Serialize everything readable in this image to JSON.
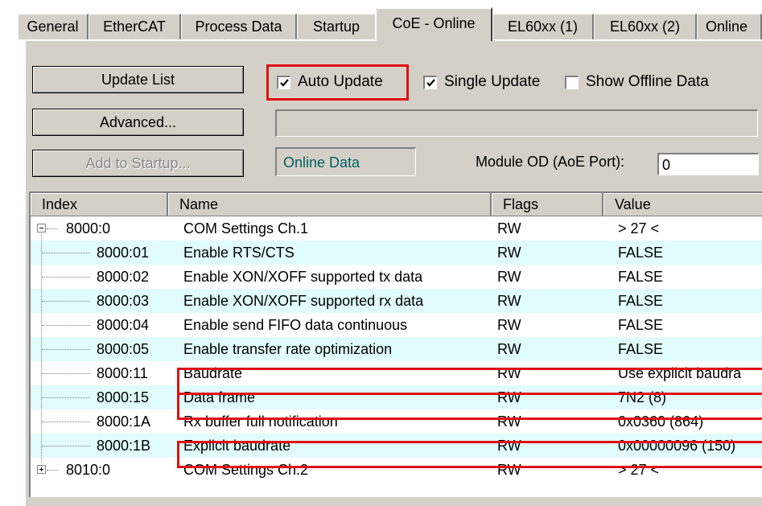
{
  "tabs": [
    {
      "label": "General",
      "active": false
    },
    {
      "label": "EtherCAT",
      "active": false
    },
    {
      "label": "Process Data",
      "active": false
    },
    {
      "label": "Startup",
      "active": false
    },
    {
      "label": "CoE - Online",
      "active": true
    },
    {
      "label": "EL60xx (1)",
      "active": false
    },
    {
      "label": "EL60xx (2)",
      "active": false
    },
    {
      "label": "Online",
      "active": false
    }
  ],
  "buttons": {
    "update_list": "Update List",
    "advanced": "Advanced...",
    "add_to_startup": "Add to Startup..."
  },
  "options": {
    "auto_update": {
      "label": "Auto Update",
      "checked": true
    },
    "single_update": {
      "label": "Single Update",
      "checked": true
    },
    "show_offline": {
      "label": "Show Offline Data",
      "checked": false
    }
  },
  "fields": {
    "status_text": "",
    "online_data": "Online Data",
    "module_od_label": "Module OD (AoE Port):",
    "module_od_value": "0"
  },
  "table": {
    "columns": [
      "Index",
      "Name",
      "Flags",
      "Value"
    ],
    "rows": [
      {
        "tree": "minus",
        "index": "8000:0",
        "name": "COM Settings Ch.1",
        "flags": "RW",
        "value": "> 27 <"
      },
      {
        "tree": "child",
        "index": "8000:01",
        "name": "Enable RTS/CTS",
        "flags": "RW",
        "value": "FALSE"
      },
      {
        "tree": "child",
        "index": "8000:02",
        "name": "Enable XON/XOFF supported tx data",
        "flags": "RW",
        "value": "FALSE"
      },
      {
        "tree": "child",
        "index": "8000:03",
        "name": "Enable XON/XOFF supported rx data",
        "flags": "RW",
        "value": "FALSE"
      },
      {
        "tree": "child",
        "index": "8000:04",
        "name": "Enable send FIFO data continuous",
        "flags": "RW",
        "value": "FALSE"
      },
      {
        "tree": "child",
        "index": "8000:05",
        "name": "Enable transfer rate optimization",
        "flags": "RW",
        "value": "FALSE"
      },
      {
        "tree": "child",
        "index": "8000:11",
        "name": "Baudrate",
        "flags": "RW",
        "value": "Use explicit baudra"
      },
      {
        "tree": "child",
        "index": "8000:15",
        "name": "Data frame",
        "flags": "RW",
        "value": "7N2 (8)"
      },
      {
        "tree": "child",
        "index": "8000:1A",
        "name": "Rx buffer full notification",
        "flags": "RW",
        "value": "0x0360 (864)"
      },
      {
        "tree": "child",
        "index": "8000:1B",
        "name": "Explicit baudrate",
        "flags": "RW",
        "value": "0x00000096 (150)"
      },
      {
        "tree": "plus",
        "index": "8010:0",
        "name": "COM Settings Ch.2",
        "flags": "RW",
        "value": "> 27 <"
      }
    ]
  },
  "colors": {
    "highlight_row": "#e1fcfc",
    "annotation_red": "#e01010",
    "dialog_face": "#d4d0c8"
  }
}
